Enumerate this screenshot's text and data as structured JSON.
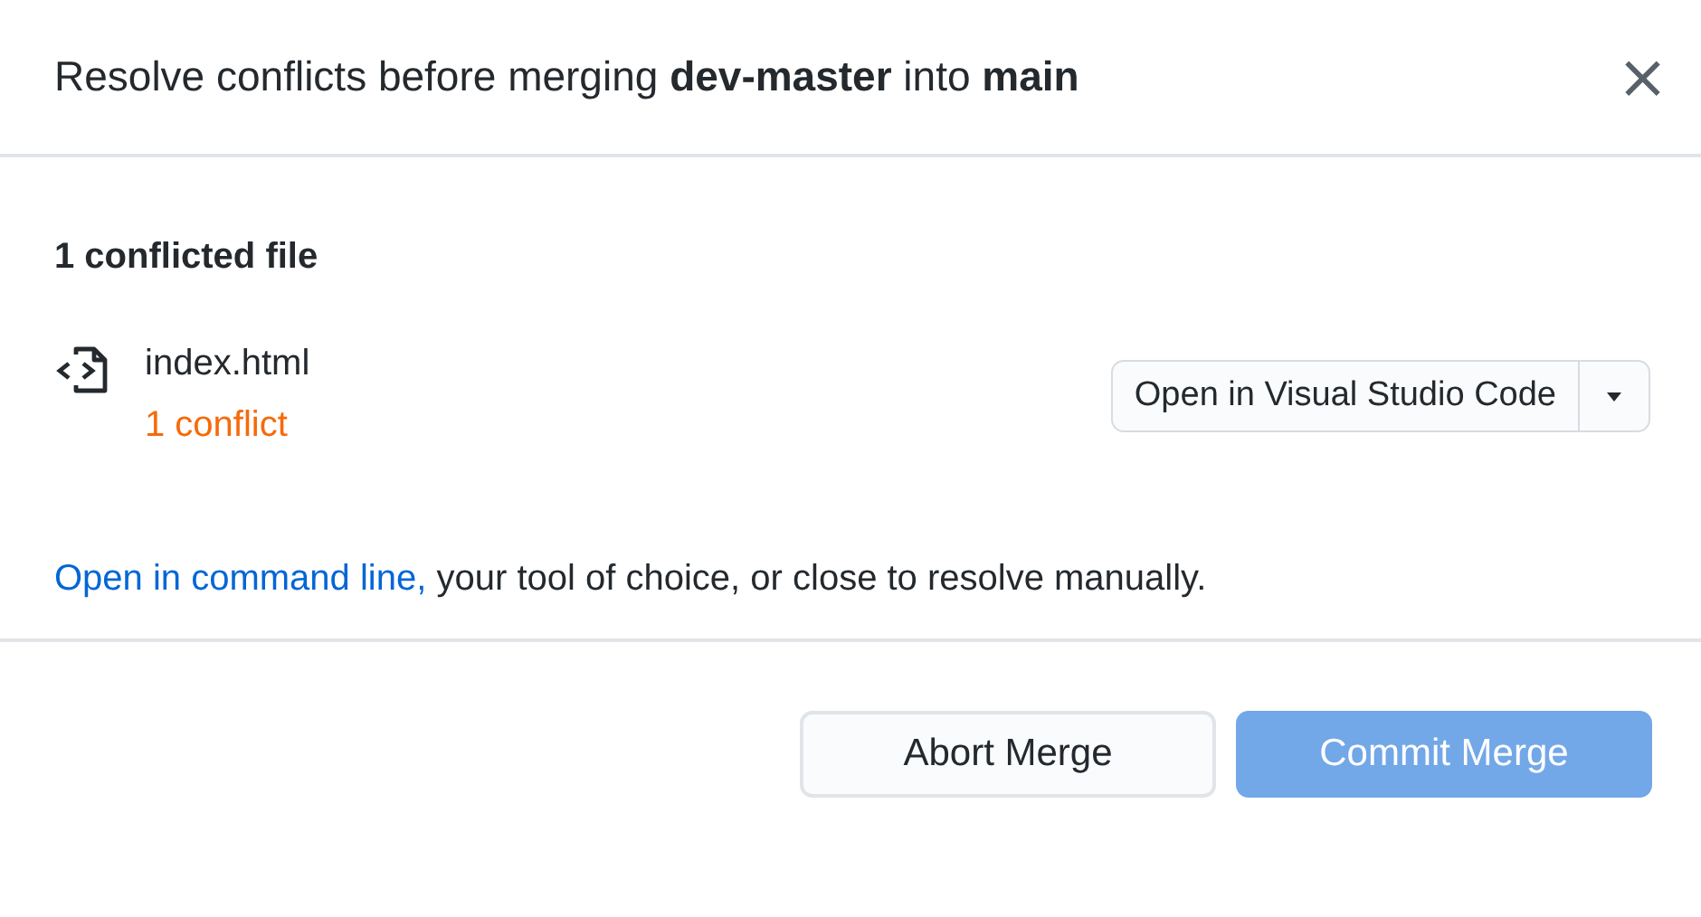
{
  "dialog": {
    "title": "Resolve conflicts before merging **dev-master** into **main**",
    "close": "×"
  },
  "section": {
    "heading": "1 conflicted file"
  },
  "files": [
    {
      "name": "index.html",
      "status": "1 conflict",
      "open_button": "Open in Visual Studio Code"
    }
  ],
  "help": {
    "link": "Open in command line,",
    "text": " your tool of choice, or close to resolve manually."
  },
  "buttons": [
    {
      "label": "Abort Merge",
      "kind": "secondary",
      "disabled": false
    },
    {
      "label": "Commit Merge",
      "kind": "primary",
      "disabled": true
    }
  ]
}
